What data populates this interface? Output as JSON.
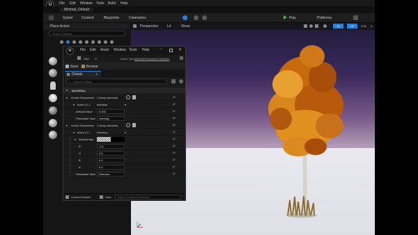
{
  "app": {
    "logo": "U",
    "menu": [
      "File",
      "Edit",
      "Window",
      "Tools",
      "Build",
      "Help"
    ],
    "project_tab": "Minimal_Default"
  },
  "toolbar": {
    "quixel": "Quixel",
    "content": "Content",
    "blueprints": "Blueprints",
    "cinematics": "Cinematics",
    "play": "Play",
    "platforms": "Platforms"
  },
  "left_panel": {
    "tab": "Place Actors",
    "search_placeholder": "Search Classes"
  },
  "viewport": {
    "perspective": "Perspective",
    "lit": "Lit",
    "show": "Show",
    "grid_value": "10",
    "angle_value": "10°",
    "scale_value": "0.25",
    "camera_speed": "4"
  },
  "asset_window": {
    "logo": "U",
    "menu": [
      "File",
      "Edit",
      "Asset",
      "Window",
      "Tools",
      "Help"
    ],
    "grid_label": "Grid",
    "asset_type_label": "Asset Type:",
    "asset_type_value": "MaterialParameterCollection",
    "save": "Save",
    "browse": "Browse",
    "details_tab": "Details",
    "search_placeholder": "Search Details",
    "section_title": "MATERIAL",
    "scalar": {
      "label": "Scalar Parameters",
      "count": "1 Array elements",
      "index_label": "Index [ 0 ]",
      "index_value": "Intensity",
      "default_label": "Default Value",
      "default_value": "0.003",
      "param_name_label": "Parameter Nam",
      "param_name_value": "Intensity"
    },
    "vector": {
      "label": "Vector Parameters",
      "count": "1 Array elements",
      "index_label": "Index [ 0 ]",
      "index_value": "Direction",
      "default_label": "Default Valu",
      "r_label": "R",
      "r_value": "-0.1",
      "g_label": "G",
      "g_value": "0.0",
      "b_label": "B",
      "b_value": "0.0",
      "a_label": "A",
      "a_value": "0.0",
      "param_name_label": "Parameter Nam",
      "param_name_value": "Direction"
    },
    "status": {
      "content_drawer": "Content Drawer",
      "cmd": "Cmd",
      "console_placeholder": "Enter Console Command"
    }
  },
  "colors": {
    "accent_blue": "#2a7fd6",
    "play_green": "#3fbf3f",
    "foliage_orange": "#d9861c"
  }
}
